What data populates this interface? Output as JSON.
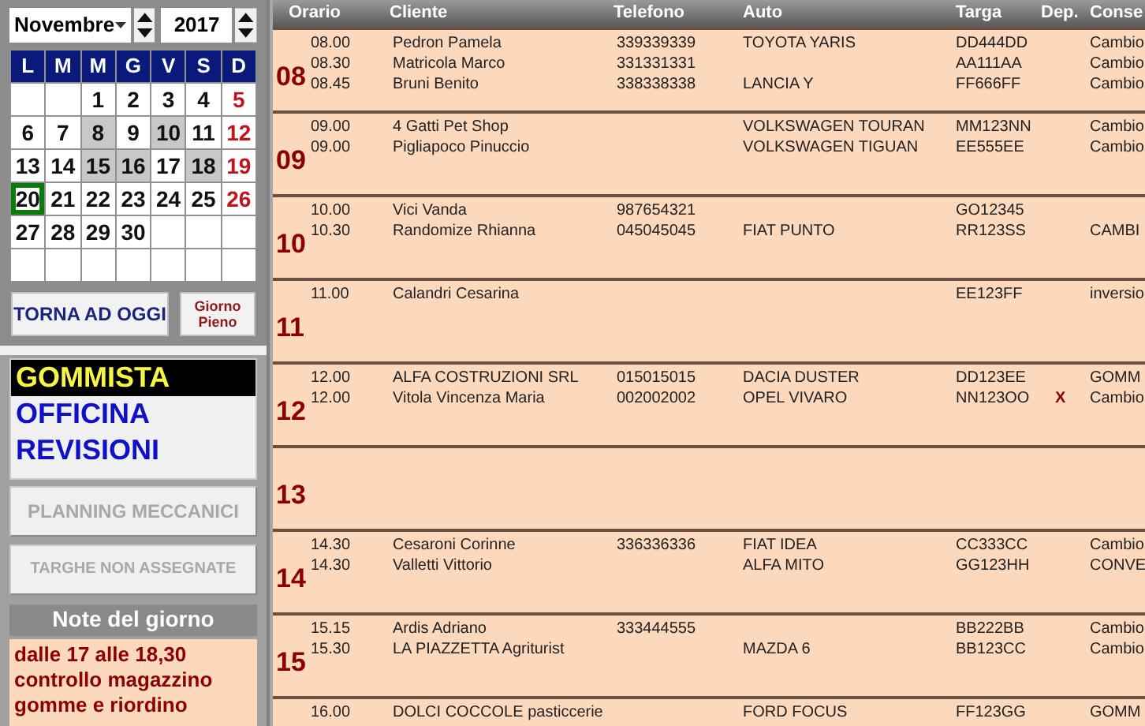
{
  "calendar": {
    "month": "Novembre",
    "year": "2017",
    "weekdays": [
      "L",
      "M",
      "M",
      "G",
      "V",
      "S",
      "D"
    ],
    "weeks": [
      [
        {
          "kind": "blank"
        },
        {
          "kind": "blank"
        },
        {
          "kind": "day",
          "day": "1",
          "marked": false,
          "selected": false
        },
        {
          "kind": "day",
          "day": "2",
          "marked": false,
          "selected": false
        },
        {
          "kind": "day",
          "day": "3",
          "marked": false,
          "selected": false
        },
        {
          "kind": "day",
          "day": "4",
          "marked": false,
          "selected": false
        },
        {
          "kind": "day",
          "day": "5",
          "marked": false,
          "selected": false
        }
      ],
      [
        {
          "kind": "day",
          "day": "6",
          "marked": false,
          "selected": false
        },
        {
          "kind": "day",
          "day": "7",
          "marked": false,
          "selected": false
        },
        {
          "kind": "day",
          "day": "8",
          "marked": true,
          "selected": false
        },
        {
          "kind": "day",
          "day": "9",
          "marked": false,
          "selected": false
        },
        {
          "kind": "day",
          "day": "10",
          "marked": true,
          "selected": false
        },
        {
          "kind": "day",
          "day": "11",
          "marked": false,
          "selected": false
        },
        {
          "kind": "day",
          "day": "12",
          "marked": false,
          "selected": false
        }
      ],
      [
        {
          "kind": "day",
          "day": "13",
          "marked": false,
          "selected": false
        },
        {
          "kind": "day",
          "day": "14",
          "marked": false,
          "selected": false
        },
        {
          "kind": "day",
          "day": "15",
          "marked": true,
          "selected": false
        },
        {
          "kind": "day",
          "day": "16",
          "marked": true,
          "selected": false
        },
        {
          "kind": "day",
          "day": "17",
          "marked": false,
          "selected": false
        },
        {
          "kind": "day",
          "day": "18",
          "marked": true,
          "selected": false
        },
        {
          "kind": "day",
          "day": "19",
          "marked": false,
          "selected": false
        }
      ],
      [
        {
          "kind": "day",
          "day": "20",
          "marked": false,
          "selected": true
        },
        {
          "kind": "day",
          "day": "21",
          "marked": false,
          "selected": false
        },
        {
          "kind": "day",
          "day": "22",
          "marked": false,
          "selected": false
        },
        {
          "kind": "day",
          "day": "23",
          "marked": false,
          "selected": false
        },
        {
          "kind": "day",
          "day": "24",
          "marked": false,
          "selected": false
        },
        {
          "kind": "day",
          "day": "25",
          "marked": false,
          "selected": false
        },
        {
          "kind": "day",
          "day": "26",
          "marked": false,
          "selected": false
        }
      ],
      [
        {
          "kind": "day",
          "day": "27",
          "marked": false,
          "selected": false
        },
        {
          "kind": "day",
          "day": "28",
          "marked": false,
          "selected": false
        },
        {
          "kind": "day",
          "day": "29",
          "marked": false,
          "selected": false
        },
        {
          "kind": "day",
          "day": "30",
          "marked": false,
          "selected": false
        },
        {
          "kind": "blank"
        },
        {
          "kind": "blank"
        },
        {
          "kind": "blank"
        }
      ],
      [
        {
          "kind": "blank"
        },
        {
          "kind": "blank"
        },
        {
          "kind": "blank"
        },
        {
          "kind": "blank"
        },
        {
          "kind": "blank"
        },
        {
          "kind": "blank"
        },
        {
          "kind": "blank"
        }
      ]
    ],
    "today_button": "TORNA AD OGGI",
    "full_day_button": "Giorno Pieno"
  },
  "departments": [
    {
      "label": "GOMMISTA",
      "selected": true
    },
    {
      "label": "OFFICINA",
      "selected": false
    },
    {
      "label": "REVISIONI",
      "selected": false
    }
  ],
  "side_buttons": [
    {
      "label": "PLANNING MECCANICI",
      "disabled": true
    },
    {
      "label": "TARGHE NON ASSEGNATE",
      "disabled": true
    }
  ],
  "notes": {
    "title": "Note del giorno",
    "text": "dalle 17 alle 18,30 controllo magazzino gomme e riordino"
  },
  "schedule": {
    "columns": [
      "Orario",
      "Cliente",
      "Telefono",
      "Auto",
      "Targa",
      "Dep.",
      "Conse"
    ],
    "hours": [
      {
        "hour": "08",
        "appointments": [
          {
            "time": "08.00",
            "client": "Pedron Pamela",
            "phone": "339339339",
            "car": "TOYOTA YARIS",
            "plate": "DD444DD",
            "service": "Cambio"
          },
          {
            "time": "08.30",
            "client": "Matricola Marco",
            "phone": "331331331",
            "plate": "AA111AA",
            "service": "Cambio"
          },
          {
            "time": "08.45",
            "client": "Bruni Benito",
            "phone": "338338338",
            "car": "LANCIA Y",
            "plate": "FF666FF",
            "service": "Cambio"
          }
        ]
      },
      {
        "hour": "09",
        "appointments": [
          {
            "time": "09.00",
            "client": "4 Gatti Pet Shop",
            "car": "VOLKSWAGEN TOURAN",
            "plate": "MM123NN",
            "service": "Cambio"
          },
          {
            "time": "09.00",
            "client": "Pigliapoco Pinuccio",
            "car": "VOLKSWAGEN TIGUAN",
            "plate": "EE555EE",
            "service": "Cambio"
          }
        ]
      },
      {
        "hour": "10",
        "appointments": [
          {
            "time": "10.00",
            "client": "Vici Vanda",
            "phone": "987654321",
            "plate": "GO12345"
          },
          {
            "time": "10.30",
            "client": "Randomize Rhianna",
            "phone": "045045045",
            "car": "FIAT PUNTO",
            "plate": "RR123SS",
            "service": "CAMBI"
          }
        ]
      },
      {
        "hour": "11",
        "appointments": [
          {
            "time": "11.00",
            "client": "Calandri Cesarina",
            "plate": "EE123FF",
            "service": "inversio"
          }
        ]
      },
      {
        "hour": "12",
        "appointments": [
          {
            "time": "12.00",
            "client": "ALFA COSTRUZIONI SRL",
            "phone": "015015015",
            "car": "DACIA DUSTER",
            "plate": "DD123EE",
            "service": "GOMM"
          },
          {
            "time": "12.00",
            "client": "Vitola Vincenza Maria",
            "phone": "002002002",
            "car": "OPEL VIVARO",
            "plate": "NN123OO",
            "dep": "X",
            "service": "Cambio"
          }
        ]
      },
      {
        "hour": "13"
      },
      {
        "hour": "14",
        "appointments": [
          {
            "time": "14.30",
            "client": "Cesaroni Corinne",
            "phone": "336336336",
            "car": "FIAT IDEA",
            "plate": "CC333CC",
            "service": "Cambio"
          },
          {
            "time": "14.30",
            "client": "Valletti Vittorio",
            "car": "ALFA MITO",
            "plate": "GG123HH",
            "service": "CONVE"
          }
        ]
      },
      {
        "hour": "15",
        "appointments": [
          {
            "time": "15.15",
            "client": "Ardis Adriano",
            "phone": "333444555",
            "plate": "BB222BB",
            "service": "Cambio"
          },
          {
            "time": "15.30",
            "client": "LA PIAZZETTA Agriturist",
            "car": "MAZDA 6",
            "plate": "BB123CC",
            "service": "Cambio"
          }
        ]
      },
      {
        "appointments": [
          {
            "time": "16.00",
            "client": "DOLCI COCCOLE pasticcerie",
            "car": "FORD FOCUS",
            "plate": "FF123GG",
            "service": "GOMM"
          }
        ]
      }
    ]
  }
}
